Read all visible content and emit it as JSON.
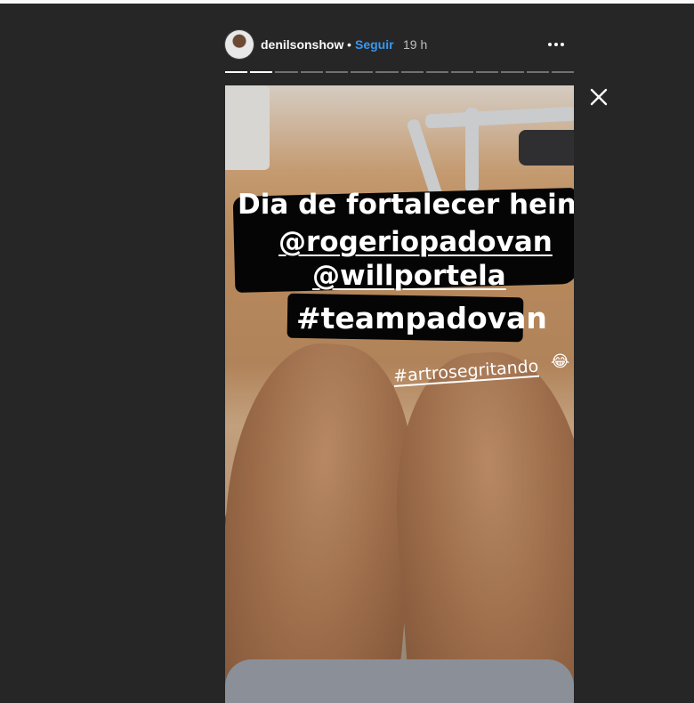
{
  "story": {
    "username": "denilsonshow",
    "separator": "•",
    "follow_label": "Seguir",
    "time": "19 h",
    "progress": {
      "total": 14,
      "viewed": 2
    }
  },
  "overlay": {
    "line1": "Dia de fortalecer hein",
    "mention1": "@rogeriopadovan",
    "mention2": "@willportela",
    "hashtag1": "#teampadovan",
    "hashtag2": "#artrosegritando",
    "emoji": "😂"
  },
  "icons": {
    "more": "more-options-icon",
    "close": "close-icon"
  },
  "colors": {
    "background": "#262626",
    "accent": "#3897f0",
    "text": "#fafafa"
  }
}
